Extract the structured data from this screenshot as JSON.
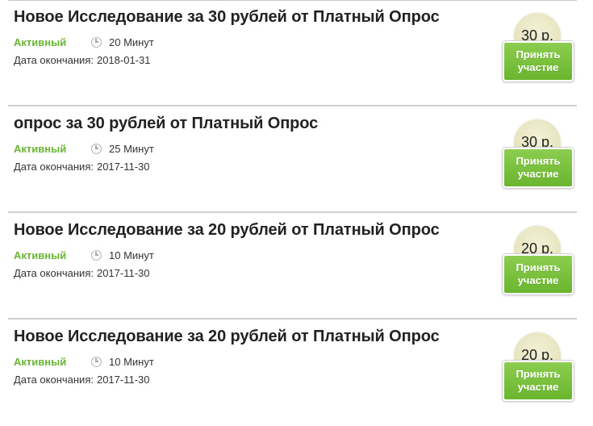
{
  "surveys": [
    {
      "title": "Новое Исследование за 30 рублей от Платный Опрос",
      "status": "Активный",
      "duration": "20 Минут",
      "end_label": "Дата окончания:",
      "end_date": "2018-01-31",
      "price": "30 р.",
      "button_line1": "Принять",
      "button_line2": "участие"
    },
    {
      "title": "опрос за 30 рублей от Платный Опрос",
      "status": "Активный",
      "duration": "25 Минут",
      "end_label": "Дата окончания:",
      "end_date": "2017-11-30",
      "price": "30 р.",
      "button_line1": "Принять",
      "button_line2": "участие"
    },
    {
      "title": "Новое Исследование за 20 рублей от Платный Опрос",
      "status": "Активный",
      "duration": "10 Минут",
      "end_label": "Дата окончания:",
      "end_date": "2017-11-30",
      "price": "20 р.",
      "button_line1": "Принять",
      "button_line2": "участие"
    },
    {
      "title": "Новое Исследование за 20 рублей от Платный Опрос",
      "status": "Активный",
      "duration": "10 Минут",
      "end_label": "Дата окончания:",
      "end_date": "2017-11-30",
      "price": "20 р.",
      "button_line1": "Принять",
      "button_line2": "участие"
    }
  ],
  "icons": {
    "duration": "clock-icon"
  },
  "colors": {
    "status": "#6ab534",
    "button": "#74bb35",
    "price_badge": "#e6e4bd"
  }
}
